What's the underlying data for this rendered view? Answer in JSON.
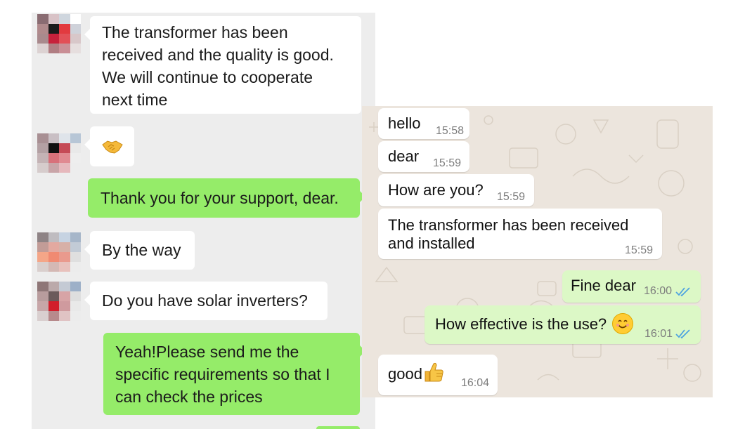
{
  "left_chat": {
    "messages": [
      {
        "sender": "contact",
        "text": "The transformer has been received and the quality is good. We will continue to cooperate next time"
      },
      {
        "sender": "contact",
        "emoji": "handshake-emoji"
      },
      {
        "sender": "self",
        "text": "Thank you for your support, dear."
      },
      {
        "sender": "contact",
        "text": "By the way"
      },
      {
        "sender": "contact",
        "text": "Do you have solar inverters?"
      },
      {
        "sender": "self",
        "text": "Yeah!Please send me the specific requirements so that I can check the prices"
      }
    ],
    "lines": {
      "m0": [
        "The transformer has been",
        "received and the quality is good.",
        "We will continue to cooperate",
        "next time"
      ],
      "m5": [
        "Yeah!Please send me the",
        "specific requirements so that I",
        "can check the prices"
      ]
    },
    "colors": {
      "background": "#ededed",
      "incoming": "#ffffff",
      "outgoing": "#95ec69"
    }
  },
  "right_chat": {
    "messages": [
      {
        "direction": "in",
        "text": "hello",
        "time": "15:58"
      },
      {
        "direction": "in",
        "text": "dear",
        "time": "15:59"
      },
      {
        "direction": "in",
        "text": "How are you?",
        "time": "15:59"
      },
      {
        "direction": "in",
        "text": "The transformer has been received and installed",
        "time": "15:59"
      },
      {
        "direction": "out",
        "text": "Fine dear",
        "time": "16:00",
        "status": "read"
      },
      {
        "direction": "out",
        "text": "How effective is the use?",
        "emoji": "smiling-face-emoji",
        "time": "16:01",
        "status": "read"
      },
      {
        "direction": "in",
        "text": "good",
        "emoji": "thumbs-up-emoji",
        "time": "16:04"
      }
    ],
    "lines": {
      "m3": [
        "The transformer has been received",
        "and installed"
      ]
    },
    "colors": {
      "background": "#ece5dd",
      "incoming": "#ffffff",
      "outgoing": "#dcf8c6",
      "read_ticks": "#4fa3e0"
    }
  }
}
